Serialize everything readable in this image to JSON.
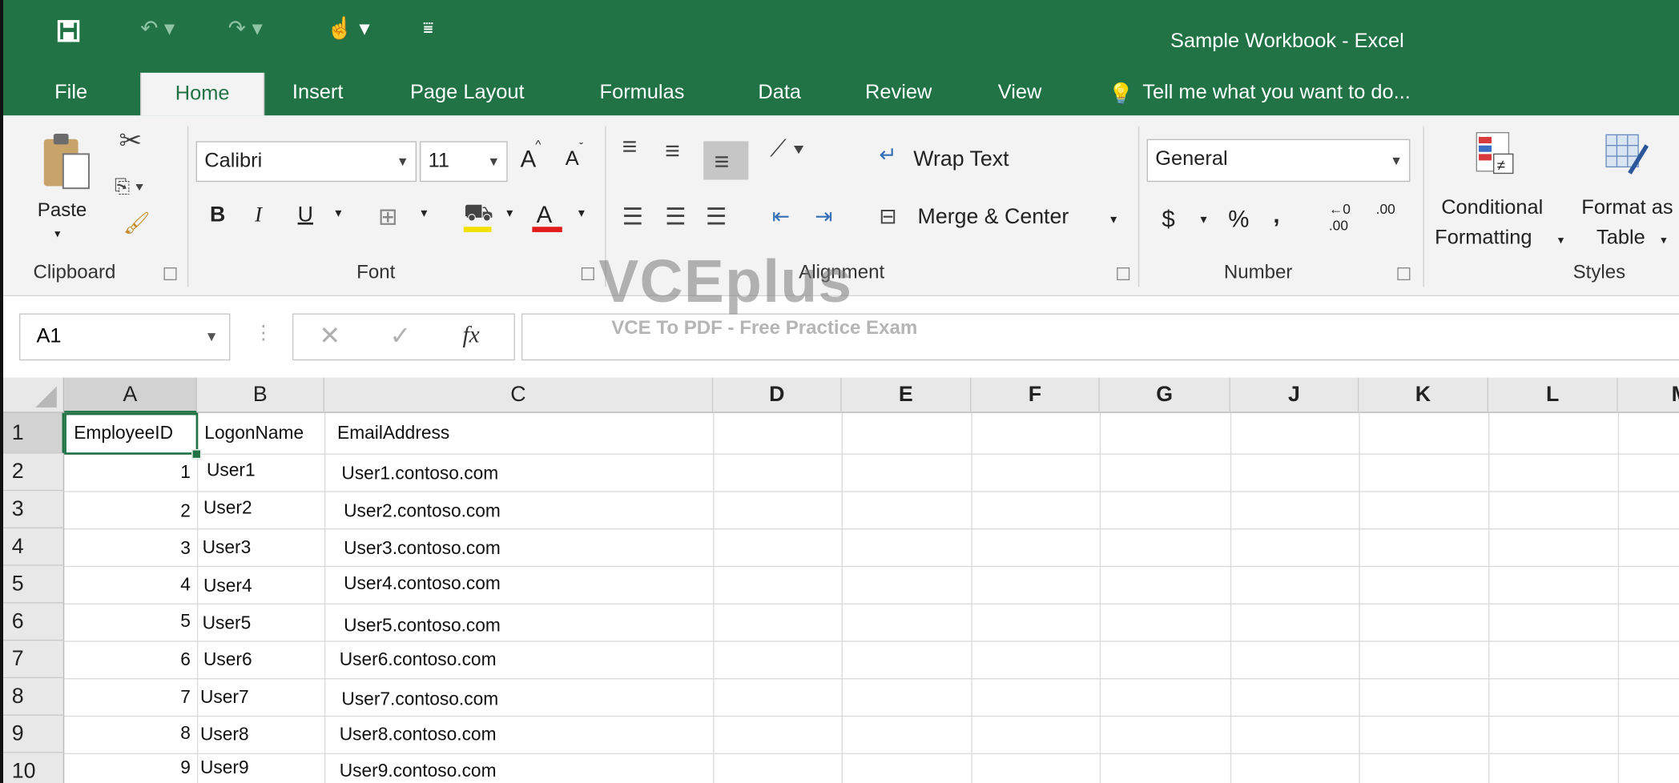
{
  "window": {
    "title": "Sample Workbook - Excel"
  },
  "tabs": [
    "File",
    "Home",
    "Insert",
    "Page Layout",
    "Formulas",
    "Data",
    "Review",
    "View"
  ],
  "tell_me": "Tell me what you want to do...",
  "ribbon": {
    "clipboard": {
      "paste": "Paste",
      "label": "Clipboard"
    },
    "font": {
      "name": "Calibri",
      "size": "11",
      "bold": "B",
      "italic": "I",
      "underline": "U",
      "increase": "A",
      "decrease": "A",
      "color_letter": "A",
      "label": "Font",
      "fill_color": "#f2e100",
      "font_color": "#e21b1b"
    },
    "alignment": {
      "wrap": "Wrap Text",
      "merge": "Merge & Center",
      "label": "Alignment"
    },
    "number": {
      "format": "General",
      "currency": "$",
      "percent": "%",
      "comma": ",",
      "inc_dec": ".00",
      "label": "Number"
    },
    "styles": {
      "conditional_1": "Conditional",
      "conditional_2": "Formatting",
      "format_1": "Format as",
      "format_2": "Table",
      "label": "Styles"
    }
  },
  "formula_bar": {
    "name_box": "A1",
    "fx": "fx"
  },
  "watermark": {
    "logo": "VCEplus",
    "sub": "VCE To PDF - Free Practice Exam"
  },
  "columns": [
    "A",
    "B",
    "C",
    "D",
    "E",
    "F",
    "G",
    "J",
    "K",
    "L",
    "M"
  ],
  "rows": [
    "1",
    "2",
    "3",
    "4",
    "5",
    "6",
    "7",
    "8",
    "9",
    "10"
  ],
  "cells": {
    "header": [
      "EmployeeID",
      "LogonName",
      "EmailAddress"
    ],
    "data": [
      [
        "1",
        "User1",
        "User1.contoso.com"
      ],
      [
        "2",
        "User2",
        "User2.contoso.com"
      ],
      [
        "3",
        "User3",
        "User3.contoso.com"
      ],
      [
        "4",
        "User4",
        "User4.contoso.com"
      ],
      [
        "5",
        "User5",
        "User5.contoso.com"
      ],
      [
        "6",
        "User6",
        "User6.contoso.com"
      ],
      [
        "7",
        "User7",
        "User7.contoso.com"
      ],
      [
        "8",
        "User8",
        "User8.contoso.com"
      ],
      [
        "9",
        "User9",
        "User9.contoso.com"
      ]
    ]
  },
  "colors": {
    "excel_green": "#217346"
  }
}
